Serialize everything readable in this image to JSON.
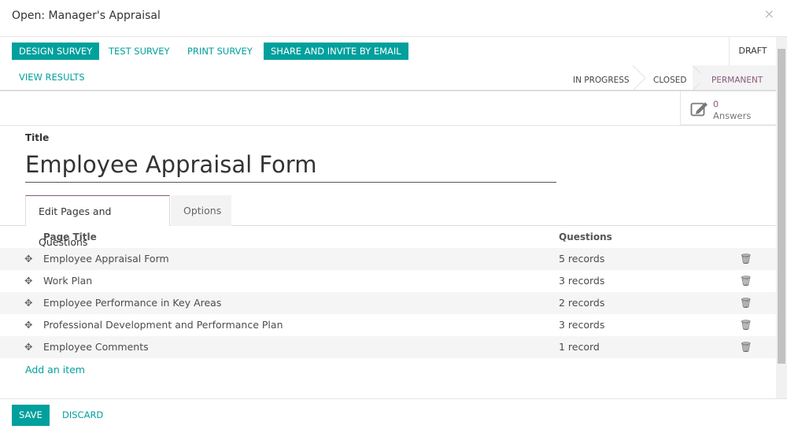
{
  "dialog": {
    "title": "Open: Manager's Appraisal",
    "close": "×"
  },
  "toolbar": {
    "design": "DESIGN SURVEY",
    "test": "TEST SURVEY",
    "print": "PRINT SURVEY",
    "share": "SHARE AND INVITE BY EMAIL",
    "results": "VIEW RESULTS"
  },
  "status": {
    "draft": "DRAFT",
    "in_progress": "IN PROGRESS",
    "closed": "CLOSED",
    "permanent": "PERMANENT",
    "active": "PERMANENT"
  },
  "stat": {
    "count": "0",
    "label": "Answers",
    "icon": "edit-icon"
  },
  "form": {
    "title_label": "Title",
    "title_value": "Employee Appraisal Form"
  },
  "tabs": [
    {
      "label": "Edit Pages and Questions",
      "active": true
    },
    {
      "label": "Options",
      "active": false
    }
  ],
  "table": {
    "headers": [
      "Page Title",
      "Questions"
    ],
    "rows": [
      {
        "title": "Employee Appraisal Form",
        "questions": "5 records"
      },
      {
        "title": "Work Plan",
        "questions": "3 records"
      },
      {
        "title": "Employee Performance in Key Areas",
        "questions": "2 records"
      },
      {
        "title": "Professional Development and Performance Plan",
        "questions": "3 records"
      },
      {
        "title": "Employee Comments",
        "questions": "1 record"
      }
    ],
    "add_item": "Add an item"
  },
  "footer": {
    "save": "SAVE",
    "discard": "DISCARD"
  },
  "colors": {
    "primary": "#00a09d",
    "active_status": "#875a7b"
  }
}
